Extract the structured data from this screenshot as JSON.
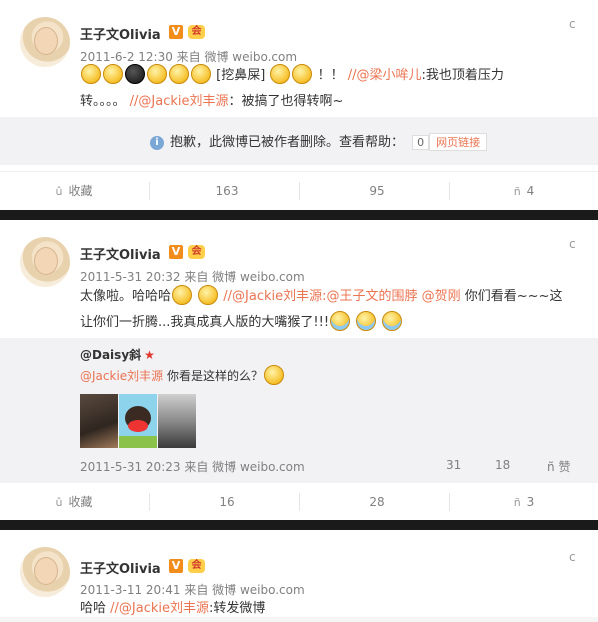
{
  "posts": [
    {
      "name": "王子文Olivia",
      "v_badge": "V",
      "crown": "会",
      "meta": "2011-6-2 12:30 来自 微博 weibo.com",
      "chevron": "c",
      "line1_mid": "[挖鼻屎]",
      "line1_bang": "！！",
      "line1_link": "//@梁小哞儿",
      "line1_tail": ":我也顶着压力",
      "line2_a": "转。。。。 ",
      "line2_link": "//@Jackie刘丰源",
      "line2_tail": "：被搞了也得转啊~",
      "deleted_msg": "抱歉，此微博已被作者删除。查看帮助：",
      "deleted_count": "0",
      "deleted_link": "网页链接",
      "info_icon": "i",
      "actions": [
        {
          "glyph": "û",
          "label": "收藏"
        },
        {
          "glyph": "",
          "label": "163"
        },
        {
          "glyph": "",
          "label": "95"
        },
        {
          "glyph": "ñ",
          "label": "4"
        }
      ]
    },
    {
      "name": "王子文Olivia",
      "v_badge": "V",
      "crown": "会",
      "meta": "2011-5-31 20:32 来自 微博 weibo.com",
      "chevron": "c",
      "line1_a": "太像啦。哈哈哈",
      "line1_link": "//@Jackie刘丰源:@王子文的围脖 @贺刚",
      "line1_tail": " 你们看看~~~这",
      "line2_a": "让你们一折腾...我真成真人版的大嘴猴了!!!",
      "repost_user": "@Daisy斜",
      "repost_star": "★",
      "repost_link": "@Jackie刘丰源",
      "repost_text": " 你看是这样的么？",
      "repost_meta": "2011-5-31 20:23 来自 微博 weibo.com",
      "repost_stats": [
        {
          "glyph": "",
          "label": "31"
        },
        {
          "glyph": "",
          "label": "18"
        },
        {
          "glyph": "ñ",
          "label": "赞"
        }
      ],
      "actions": [
        {
          "glyph": "û",
          "label": "收藏"
        },
        {
          "glyph": "",
          "label": "16"
        },
        {
          "glyph": "",
          "label": "28"
        },
        {
          "glyph": "ñ",
          "label": "3"
        }
      ]
    },
    {
      "name": "王子文Olivia",
      "v_badge": "V",
      "crown": "会",
      "meta": "2011-3-11 20:41 来自 微博 weibo.com",
      "chevron": "c",
      "text_a": "哈哈 ",
      "text_link": "//@Jackie刘丰源",
      "text_tail": ":转发微博"
    }
  ],
  "colors": {
    "link": "#eb7350",
    "separator": "#1a1a1a",
    "repost_bg": "#f2f2f5"
  }
}
